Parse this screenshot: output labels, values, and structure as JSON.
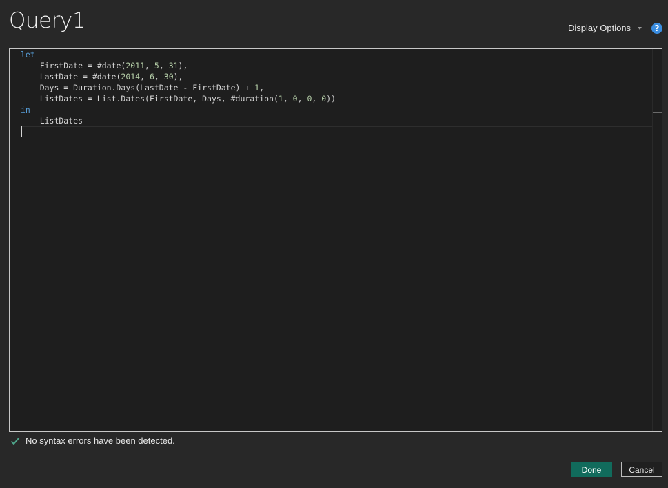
{
  "dialog": {
    "title": "Query1",
    "display_options_label": "Display Options",
    "help_label": "?"
  },
  "editor": {
    "lines": [
      {
        "tokens": [
          {
            "t": "let",
            "c": "kw"
          }
        ]
      },
      {
        "tokens": [
          {
            "t": "    FirstDate = #date(",
            "c": ""
          },
          {
            "t": "2011",
            "c": "num"
          },
          {
            "t": ", ",
            "c": ""
          },
          {
            "t": "5",
            "c": "num"
          },
          {
            "t": ", ",
            "c": ""
          },
          {
            "t": "31",
            "c": "num"
          },
          {
            "t": "),",
            "c": ""
          }
        ]
      },
      {
        "tokens": [
          {
            "t": "    LastDate = #date(",
            "c": ""
          },
          {
            "t": "2014",
            "c": "num"
          },
          {
            "t": ", ",
            "c": ""
          },
          {
            "t": "6",
            "c": "num"
          },
          {
            "t": ", ",
            "c": ""
          },
          {
            "t": "30",
            "c": "num"
          },
          {
            "t": "),",
            "c": ""
          }
        ]
      },
      {
        "tokens": [
          {
            "t": "    Days = Duration.Days(LastDate - FirstDate) + ",
            "c": ""
          },
          {
            "t": "1",
            "c": "num"
          },
          {
            "t": ",",
            "c": ""
          }
        ]
      },
      {
        "tokens": [
          {
            "t": "    ListDates = List.Dates(FirstDate, Days, #duration(",
            "c": ""
          },
          {
            "t": "1",
            "c": "num"
          },
          {
            "t": ", ",
            "c": ""
          },
          {
            "t": "0",
            "c": "num"
          },
          {
            "t": ", ",
            "c": ""
          },
          {
            "t": "0",
            "c": "num"
          },
          {
            "t": ", ",
            "c": ""
          },
          {
            "t": "0",
            "c": "num"
          },
          {
            "t": "))",
            "c": ""
          }
        ]
      },
      {
        "tokens": [
          {
            "t": "in",
            "c": "kw"
          }
        ]
      },
      {
        "tokens": [
          {
            "t": "    ListDates",
            "c": ""
          }
        ]
      },
      {
        "tokens": [
          {
            "t": "",
            "c": ""
          }
        ]
      }
    ]
  },
  "status": {
    "message": "No syntax errors have been detected."
  },
  "buttons": {
    "done_label": "Done",
    "cancel_label": "Cancel"
  },
  "colors": {
    "keyword": "#569cd6",
    "number": "#b5cea8",
    "done_button": "#116b5c",
    "success_check": "#4ea58a"
  }
}
